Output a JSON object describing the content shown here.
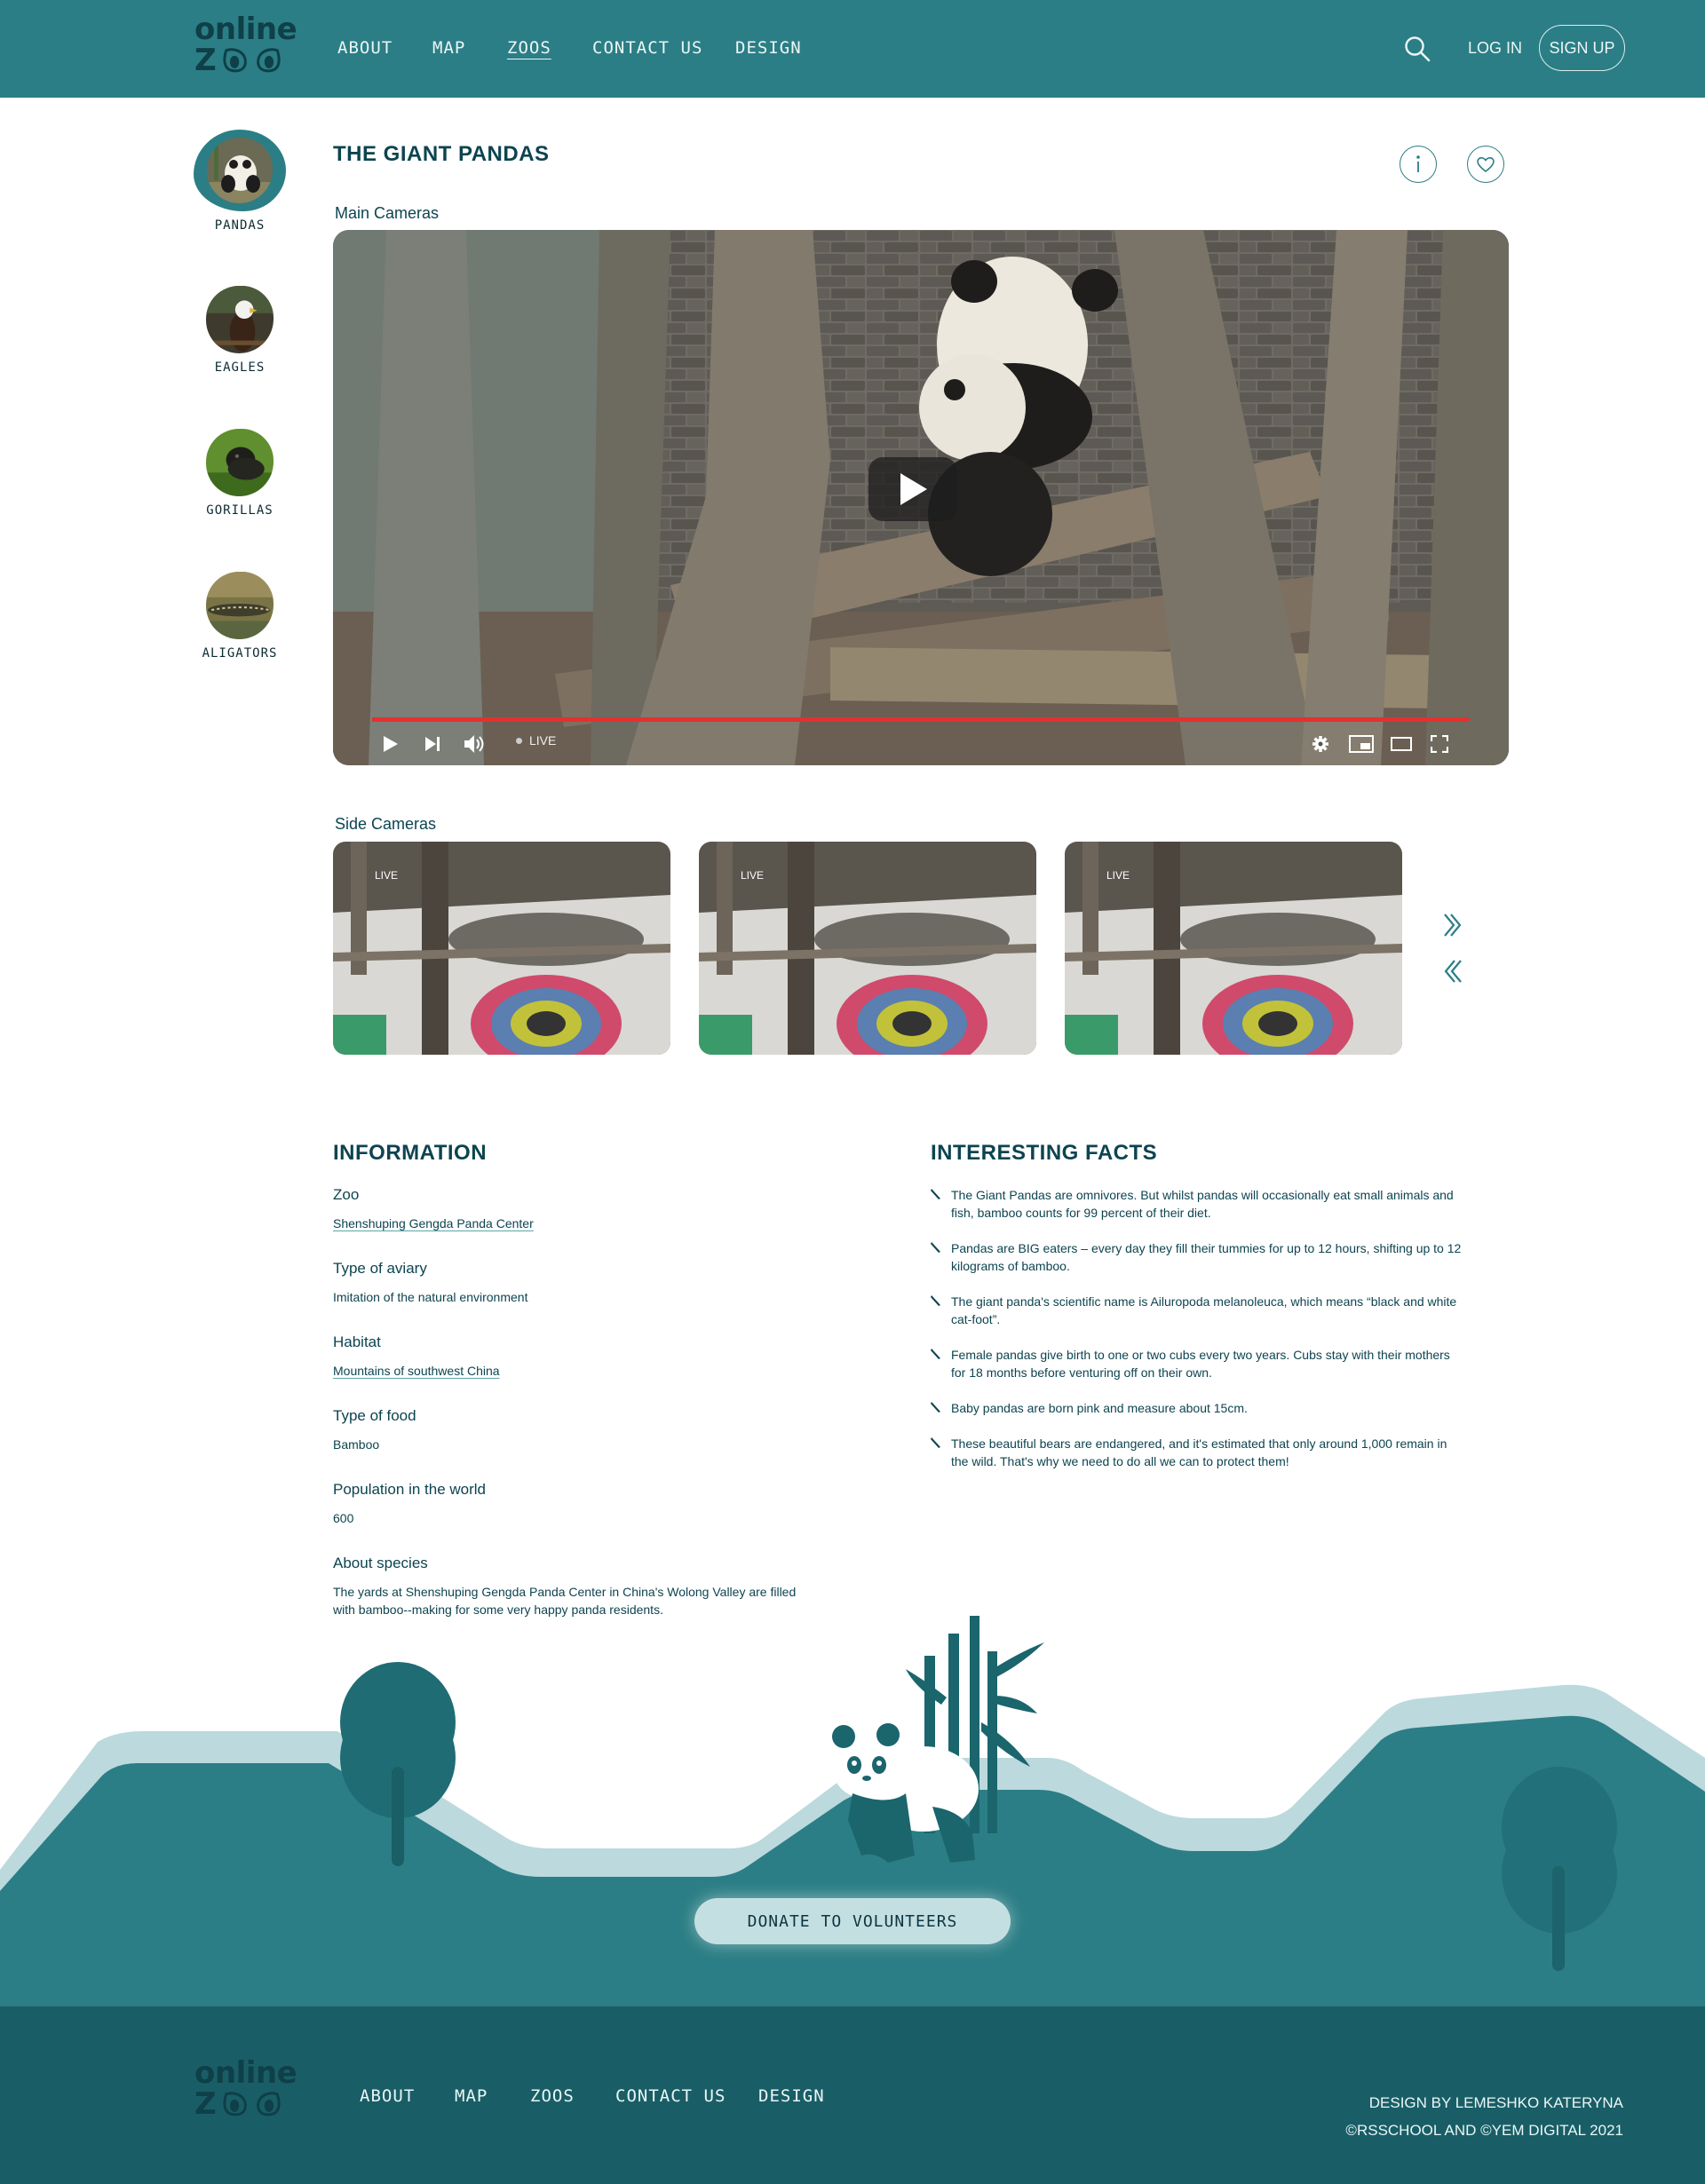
{
  "brand": {
    "logo_line1": "online",
    "logo_z": "Z"
  },
  "nav": {
    "items": [
      {
        "label": "ABOUT"
      },
      {
        "label": "MAP"
      },
      {
        "label": "ZOOS",
        "active": true
      },
      {
        "label": "CONTACT US"
      },
      {
        "label": "DESIGN"
      }
    ],
    "login": "LOG IN",
    "signup": "SIGN UP"
  },
  "icons": {
    "search": "search-icon",
    "info": "info-icon",
    "favorite": "heart-icon",
    "play": "play-icon",
    "next": "skip-next-icon",
    "volume": "volume-icon",
    "settings": "gear-icon",
    "miniplayer": "miniplayer-icon",
    "theater": "theater-mode-icon",
    "fullscreen": "fullscreen-icon",
    "slider_next": "chevron-double-right-icon",
    "slider_prev": "chevron-double-left-icon"
  },
  "colors": {
    "primary": "#2b7e85",
    "dark_teal": "#195e66",
    "text": "#0d4450",
    "progress": "#e53030",
    "donate_bg": "#c4dfe2"
  },
  "sidebar": {
    "animals": [
      {
        "label": "PANDAS",
        "active": true
      },
      {
        "label": "EAGLES"
      },
      {
        "label": "GORILLAS"
      },
      {
        "label": "ALIGATORS"
      }
    ]
  },
  "page": {
    "title": "THE GIANT PANDAS"
  },
  "main_cameras": {
    "label": "Main Cameras",
    "live_label": "LIVE"
  },
  "side_cameras": {
    "label": "Side Cameras",
    "cams": [
      {
        "live": "LIVE"
      },
      {
        "live": "LIVE"
      },
      {
        "live": "LIVE"
      }
    ]
  },
  "information": {
    "title": "INFORMATION",
    "items": [
      {
        "key": "Zoo",
        "value": "Shenshuping Gengda Panda Center",
        "link": true
      },
      {
        "key": "Type of aviary",
        "value": "Imitation of the natural environment"
      },
      {
        "key": "Habitat",
        "value": "Mountains of southwest China",
        "link": true
      },
      {
        "key": "Type of food",
        "value": "Bamboo"
      },
      {
        "key": "Population in the world",
        "value": "600"
      },
      {
        "key": "About species",
        "value": "The yards at Shenshuping Gengda Panda Center in China's Wolong Valley are filled with bamboo--making for some very happy panda residents."
      }
    ]
  },
  "facts": {
    "title": "INTERESTING FACTS",
    "items": [
      "The Giant Pandas are omnivores. But whilst pandas will occasionally eat small animals and fish, bamboo counts for 99 percent of their diet.",
      "Pandas are BIG eaters – every day they fill their tummies for up to 12 hours, shifting up to 12 kilograms of bamboo.",
      "The giant panda's scientific name is Ailuropoda melanoleuca, which means “black and white cat-foot”.",
      "Female pandas give birth to one or two cubs every two years. Cubs stay with their mothers for 18 months before venturing off on their own.",
      "Baby pandas are born pink and measure about 15cm.",
      "These beautiful bears are endangered, and it's estimated that only around 1,000 remain in the wild. That's why we need to do all we can to protect them!"
    ]
  },
  "donate": {
    "label": "DONATE TO VOLUNTEERS"
  },
  "footer": {
    "nav": [
      "ABOUT",
      "MAP",
      "ZOOS",
      "CONTACT US",
      "DESIGN"
    ],
    "design_credit": "DESIGN BY LEMESHKO KATERYNA",
    "copyright": "©RSSCHOOL AND ©YEM DIGITAL 2021"
  }
}
